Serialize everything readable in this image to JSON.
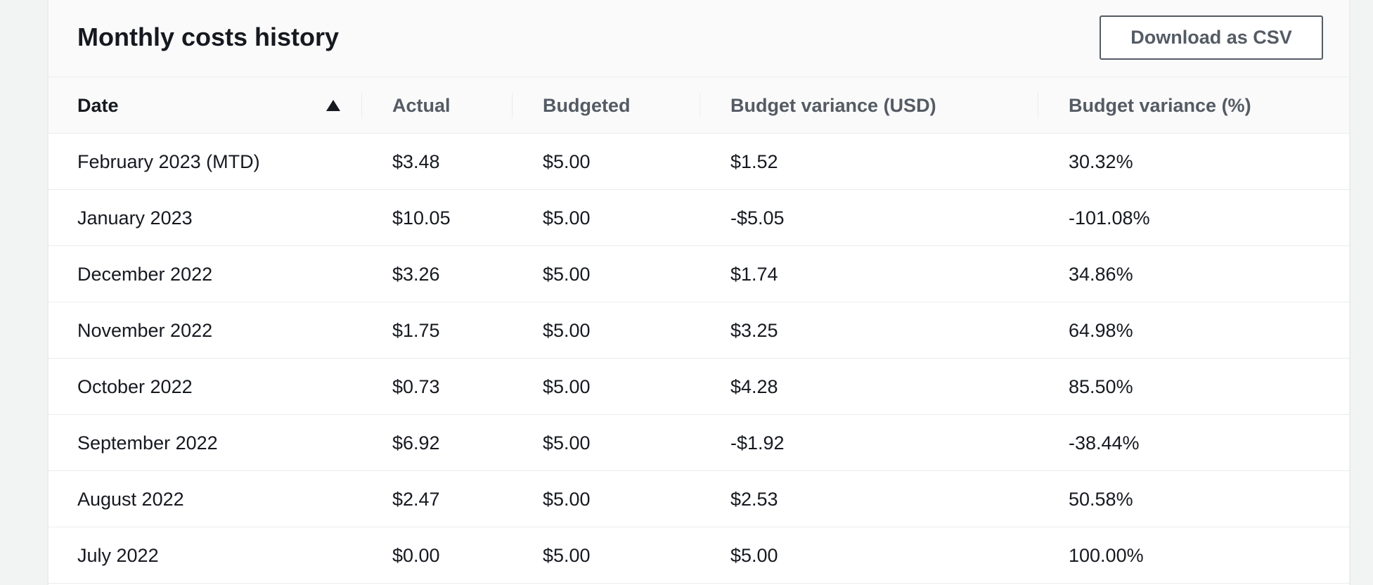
{
  "panel": {
    "title": "Monthly costs history",
    "download_label": "Download as CSV"
  },
  "table": {
    "sort": {
      "column": "Date",
      "direction": "ascending",
      "icon": "sort-ascending-icon"
    },
    "columns": [
      "Date",
      "Actual",
      "Budgeted",
      "Budget variance (USD)",
      "Budget variance (%)"
    ],
    "rows": [
      [
        "February 2023 (MTD)",
        "$3.48",
        "$5.00",
        "$1.52",
        "30.32%"
      ],
      [
        "January 2023",
        "$10.05",
        "$5.00",
        "-$5.05",
        "-101.08%"
      ],
      [
        "December 2022",
        "$3.26",
        "$5.00",
        "$1.74",
        "34.86%"
      ],
      [
        "November 2022",
        "$1.75",
        "$5.00",
        "$3.25",
        "64.98%"
      ],
      [
        "October 2022",
        "$0.73",
        "$5.00",
        "$4.28",
        "85.50%"
      ],
      [
        "September 2022",
        "$6.92",
        "$5.00",
        "-$1.92",
        "-38.44%"
      ],
      [
        "August 2022",
        "$2.47",
        "$5.00",
        "$2.53",
        "50.58%"
      ],
      [
        "July 2022",
        "$0.00",
        "$5.00",
        "$5.00",
        "100.00%"
      ]
    ]
  },
  "colors": {
    "page_background": "#f2f3f3",
    "panel_background": "#ffffff",
    "header_background": "#fafafa",
    "text": "#16191f",
    "secondary_text": "#545b64",
    "border": "#eaeded"
  }
}
